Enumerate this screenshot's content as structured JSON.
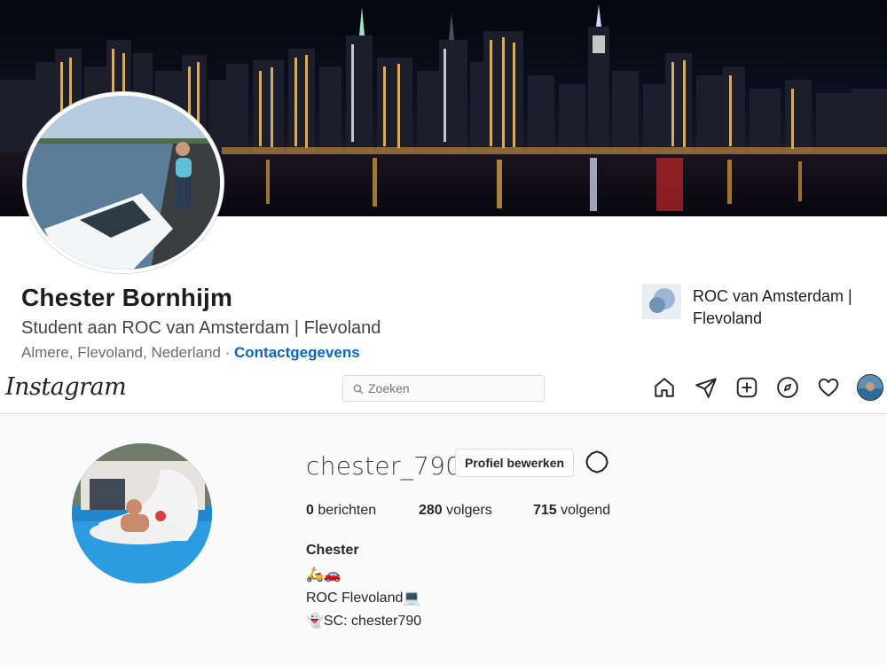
{
  "linkedin": {
    "name": "Chester Bornhijm",
    "headline": "Student aan ROC van Amsterdam | Flevoland",
    "location": "Almere, Flevoland, Nederland",
    "separator": " · ",
    "contact_link": "Contactgegevens",
    "school": "ROC van Amsterdam | Flevoland"
  },
  "instagram": {
    "logo": "Instagram",
    "search_placeholder": "Zoeken",
    "nav_icons": [
      "home-icon",
      "direct-message-icon",
      "new-post-icon",
      "explore-icon",
      "activity-heart-icon"
    ],
    "username": "chester_790",
    "edit_profile_label": "Profiel bewerken",
    "stats": {
      "posts_count": "0",
      "posts_label": " berichten",
      "followers_count": "280",
      "followers_label": " volgers",
      "following_count": "715",
      "following_label": " volgend"
    },
    "bio": {
      "full_name": "Chester",
      "line1": "🛵🚗",
      "line2": "ROC Flevoland💻",
      "line3": "👻SC: chester790"
    }
  }
}
